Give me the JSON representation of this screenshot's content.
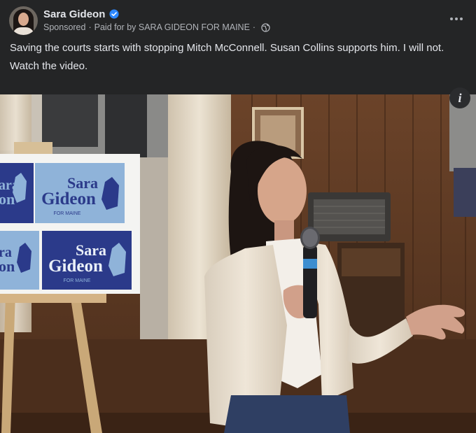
{
  "post": {
    "page_name": "Sara Gideon",
    "sponsored": "Sponsored",
    "paid_for": "Paid for by SARA GIDEON FOR MAINE",
    "text_line_1": "Saving the courts starts with stopping Mitch McConnell. Susan Collins supports him. I will not.",
    "text_line_2": "Watch the video.",
    "info_label": "i"
  },
  "video": {
    "sign_name_first": "Sara",
    "sign_name_last": "Gideon",
    "sign_subtitle": "FOR MAINE",
    "sign_partial_1": "ara",
    "sign_partial_2": "on",
    "sign_partial_3": "ra",
    "sign_partial_4": "on"
  },
  "colors": {
    "background": "#242526",
    "text_primary": "#e4e6eb",
    "text_secondary": "#b0b3b8",
    "verified_blue": "#2d88ff",
    "sign_blue_dark": "#2b3a8a",
    "sign_blue_light": "#8fb3d9"
  },
  "icons": {
    "verified": "verified-badge-icon",
    "globe": "globe-icon",
    "more": "more-options-icon",
    "info": "info-icon"
  }
}
